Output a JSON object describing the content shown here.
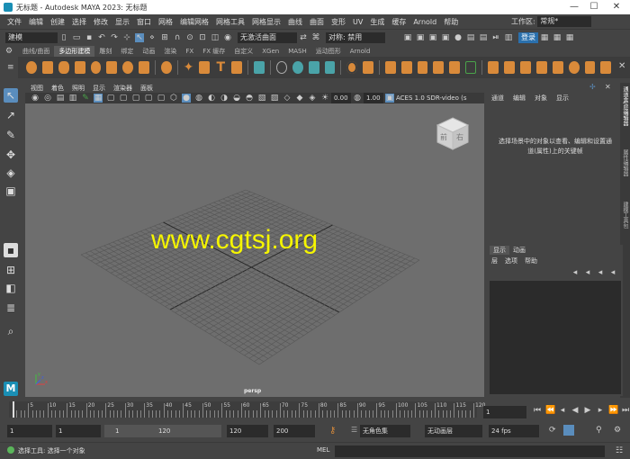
{
  "window": {
    "title": "无标题 - Autodesk MAYA 2023: 无标题",
    "minimize": "—",
    "maximize": "☐",
    "close": "✕"
  },
  "menubar": {
    "items": [
      "文件",
      "编辑",
      "创建",
      "选择",
      "修改",
      "显示",
      "窗口",
      "网格",
      "编辑网格",
      "网格工具",
      "网格显示",
      "曲线",
      "曲面",
      "变形",
      "UV",
      "生成",
      "缓存",
      "Arnold",
      "帮助"
    ],
    "workspace_label": "工作区:",
    "workspace_value": "常规*"
  },
  "statusline": {
    "mode": "建模",
    "live_object": "无激活曲面",
    "symmetry": "对称: 禁用",
    "login": "登录"
  },
  "shelf": {
    "tabs": [
      "曲线/曲面",
      "多边形建模",
      "雕刻",
      "绑定",
      "动画",
      "渲染",
      "FX",
      "FX 缓存",
      "自定义",
      "XGen",
      "MASH",
      "运动图形",
      "Arnold"
    ],
    "active_tab": "多边形建模"
  },
  "viewport": {
    "menu": [
      "视图",
      "着色",
      "照明",
      "显示",
      "渲染器",
      "面板"
    ],
    "value1": "0.00",
    "value2": "1.00",
    "colorspace": "ACES 1.0 SDR-video (s",
    "camera": "persp",
    "watermark": "www.cgtsj.org",
    "cube_front": "前",
    "cube_right": "右",
    "axis_x": "x",
    "axis_y": "y",
    "axis_z": "z"
  },
  "channelbox": {
    "menu": [
      "通道",
      "编辑",
      "对象",
      "显示"
    ],
    "message": "选择场景中的对象以查看、编辑和设置通道(属性)上的关键帧"
  },
  "side_tabs": [
    "通道盒/层编辑器",
    "属性编辑器",
    "建模工具包"
  ],
  "layers": {
    "tabs": [
      "显示",
      "动画"
    ],
    "menu": [
      "层",
      "选项",
      "帮助"
    ]
  },
  "timeslider": {
    "ticks": [
      "5",
      "10",
      "15",
      "20",
      "25",
      "30",
      "35",
      "40",
      "45",
      "50",
      "55",
      "60",
      "65",
      "70",
      "75",
      "80",
      "85",
      "90",
      "95",
      "100",
      "105",
      "110",
      "115",
      "120"
    ],
    "current_frame": "1"
  },
  "range": {
    "start": "1",
    "playback_start": "1",
    "slider_start": "1",
    "slider_end": "120",
    "playback_end": "120",
    "end": "200",
    "character_set": "无角色集",
    "anim_layer": "无动画层",
    "fps": "24 fps"
  },
  "commandline": {
    "help": "选择工具: 选择一个对象",
    "lang": "MEL"
  }
}
